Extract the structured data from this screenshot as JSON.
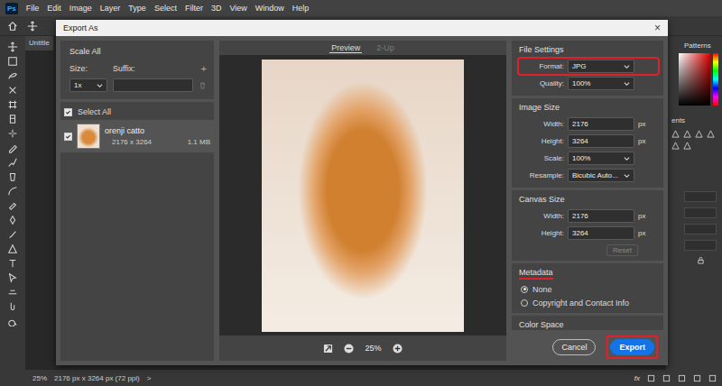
{
  "app": {
    "logo": "Ps",
    "menu": [
      "File",
      "Edit",
      "Image",
      "Layer",
      "Type",
      "Select",
      "Filter",
      "3D",
      "View",
      "Window",
      "Help"
    ]
  },
  "document_tab": {
    "label": "Untitle"
  },
  "dialog": {
    "title": "Export As",
    "close": "×"
  },
  "scale_panel": {
    "title": "Scale All",
    "size_label": "Size:",
    "suffix_label": "Suffix:",
    "add": "+",
    "size_value": "1x",
    "suffix_value": ""
  },
  "select_all": {
    "label": "Select All",
    "checked": true
  },
  "assets": [
    {
      "name": "orenji catto",
      "dimensions": "2176 x 3264",
      "file_size": "1.1 MB",
      "checked": true,
      "selected": true
    }
  ],
  "preview": {
    "tabs": [
      {
        "label": "Preview",
        "selected": true,
        "disabled": false
      },
      {
        "label": "2-Up",
        "selected": false,
        "disabled": true
      }
    ],
    "zoom": "25%"
  },
  "file_settings": {
    "title": "File Settings",
    "fields": [
      {
        "label": "Format:",
        "value": "JPG",
        "kind": "select",
        "annotated": true
      },
      {
        "label": "Quality:",
        "value": "100%",
        "kind": "select",
        "annotated": false
      }
    ]
  },
  "image_size": {
    "title": "Image Size",
    "fields": [
      {
        "label": "Width:",
        "value": "2176",
        "unit": "px",
        "kind": "input",
        "annotated": false
      },
      {
        "label": "Height:",
        "value": "3264",
        "unit": "px",
        "kind": "input",
        "annotated": false
      },
      {
        "label": "Scale:",
        "value": "100%",
        "kind": "select",
        "annotated": false
      },
      {
        "label": "Resample:",
        "value": "Bicubic Auto...",
        "kind": "select",
        "annotated": false
      }
    ]
  },
  "canvas_size": {
    "title": "Canvas Size",
    "fields": [
      {
        "label": "Width:",
        "value": "2176",
        "unit": "px",
        "kind": "input",
        "annotated": false
      },
      {
        "label": "Height:",
        "value": "3264",
        "unit": "px",
        "kind": "input",
        "annotated": false
      }
    ],
    "reset": {
      "label": "Reset",
      "disabled": true
    }
  },
  "metadata": {
    "title": "Metadata",
    "annotated": true,
    "options": [
      {
        "label": "None",
        "selected": true
      },
      {
        "label": "Copyright and Contact Info",
        "selected": false
      }
    ]
  },
  "color_space": {
    "title": "Color Space"
  },
  "buttons": [
    {
      "label": "Cancel",
      "primary": false,
      "annotated": false
    },
    {
      "label": "Export",
      "primary": true,
      "annotated": true
    }
  ],
  "right_panels": {
    "tab": "Patterns",
    "section": "ents"
  },
  "status_bar": {
    "zoom": "25%",
    "info": "2176 px x 3264 px (72 ppi)",
    "arrow": ">",
    "fx": "fx"
  }
}
